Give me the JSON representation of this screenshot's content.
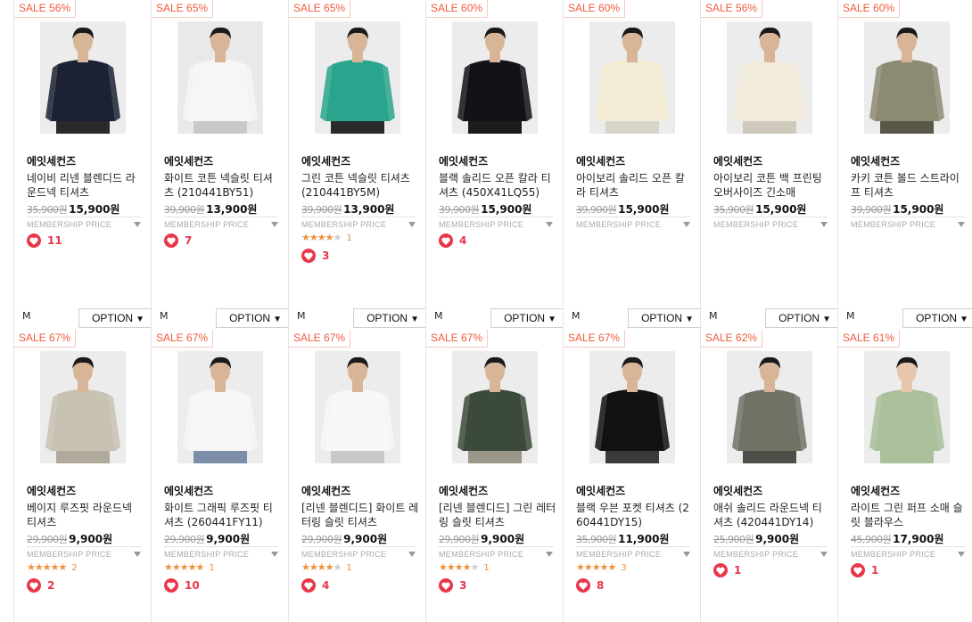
{
  "colors": {
    "sale": "#ef5a3c",
    "heart": "#e8364a",
    "star": "#f0903a"
  },
  "labels": {
    "membership": "MEMBERSHIP PRICE",
    "option": "OPTION",
    "option_arrow": "▼",
    "heart_icon": "heart-icon",
    "stars_icon": "star-rating-icon"
  },
  "rows": [
    {
      "products": [
        {
          "sale": "SALE 56%",
          "brand": "에잇세컨즈",
          "name": "네이비 리넨 블렌디드 라운드넥 티셔츠",
          "orig": "35,900원",
          "price": "15,900원",
          "rating": 0,
          "reviews": "",
          "likes": "11",
          "size": "M",
          "shirt": "#1c2233",
          "skin": "#d8b597",
          "pants": "#2a2a2a",
          "bg": "#ececec"
        },
        {
          "sale": "SALE 65%",
          "brand": "에잇세컨즈",
          "name": "화이트 코튼 넥슬릿 티셔츠 (210441BY51)",
          "orig": "39,900원",
          "price": "13,900원",
          "rating": 0,
          "reviews": "",
          "likes": "7",
          "size": "M",
          "shirt": "#f6f6f4",
          "skin": "#d8b597",
          "pants": "#c9c9c9",
          "bg": "#e9e9e9"
        },
        {
          "sale": "SALE 65%",
          "brand": "에잇세컨즈",
          "name": "그린 코튼 넥슬릿 티셔츠 (210441BY5M)",
          "orig": "39,900원",
          "price": "13,900원",
          "rating": 4,
          "reviews": "1",
          "likes": "3",
          "size": "M",
          "shirt": "#2aa58d",
          "skin": "#d8b597",
          "pants": "#2a2a2a",
          "bg": "#ececec"
        },
        {
          "sale": "SALE 60%",
          "brand": "에잇세컨즈",
          "name": "블랙 솔리드 오픈 칼라 티셔츠 (450X41LQ55)",
          "orig": "39,900원",
          "price": "15,900원",
          "rating": 0,
          "reviews": "",
          "likes": "4",
          "size": "M",
          "shirt": "#111318",
          "skin": "#d8b597",
          "pants": "#1b1b1b",
          "bg": "#ececec"
        },
        {
          "sale": "SALE 60%",
          "brand": "에잇세컨즈",
          "name": "아이보리 솔리드 오픈 칼라 티셔츠",
          "orig": "39,900원",
          "price": "15,900원",
          "rating": 0,
          "reviews": "",
          "likes": "",
          "size": "M",
          "shirt": "#f3ecd4",
          "skin": "#d8b597",
          "pants": "#d8d4c8",
          "bg": "#ececec"
        },
        {
          "sale": "SALE 56%",
          "brand": "에잇세컨즈",
          "name": "아이보리 코튼 백 프린팅 오버사이즈 긴소매",
          "orig": "35,900원",
          "price": "15,900원",
          "rating": 0,
          "reviews": "",
          "likes": "",
          "size": "M",
          "shirt": "#f1ebdc",
          "skin": "#d8b597",
          "pants": "#cfc9bb",
          "bg": "#ececec"
        },
        {
          "sale": "SALE 60%",
          "brand": "에잇세컨즈",
          "name": "카키 코튼 볼드 스트라이프 티셔츠",
          "orig": "39,900원",
          "price": "15,900원",
          "rating": 0,
          "reviews": "",
          "likes": "",
          "size": "M",
          "shirt": "#8d8a74",
          "skin": "#d8b597",
          "pants": "#5a5648",
          "bg": "#ececec"
        }
      ]
    },
    {
      "products": [
        {
          "sale": "SALE 67%",
          "brand": "에잇세컨즈",
          "name": "베이지 루즈핏 라운드넥 티셔츠",
          "orig": "29,900원",
          "price": "9,900원",
          "rating": 4.5,
          "reviews": "2",
          "likes": "2",
          "size": "",
          "shirt": "#c8c2b3",
          "skin": "#d8b597",
          "pants": "#b0aa9c",
          "bg": "#ececec"
        },
        {
          "sale": "SALE 67%",
          "brand": "에잇세컨즈",
          "name": "화이트 그래픽 루즈핏 티셔츠 (260441FY11)",
          "orig": "29,900원",
          "price": "9,900원",
          "rating": 5,
          "reviews": "1",
          "likes": "10",
          "size": "",
          "shirt": "#f7f7f7",
          "skin": "#d8b597",
          "pants": "#7d8fa8",
          "bg": "#ececec"
        },
        {
          "sale": "SALE 67%",
          "brand": "에잇세컨즈",
          "name": "[리넨 블렌디드] 화이트 레터링 슬릿 티셔츠",
          "orig": "29,900원",
          "price": "9,900원",
          "rating": 4,
          "reviews": "1",
          "likes": "4",
          "size": "",
          "shirt": "#f8f8f8",
          "skin": "#d8b597",
          "pants": "#c8c8c8",
          "bg": "#ececec"
        },
        {
          "sale": "SALE 67%",
          "brand": "에잇세컨즈",
          "name": "[리넨 블렌디드] 그린 레터링 슬릿 티셔츠",
          "orig": "29,900원",
          "price": "9,900원",
          "rating": 4,
          "reviews": "1",
          "likes": "3",
          "size": "",
          "shirt": "#3b4a3a",
          "skin": "#d8b597",
          "pants": "#9a9688",
          "bg": "#ececec"
        },
        {
          "sale": "SALE 67%",
          "brand": "에잇세컨즈",
          "name": "블랙 우븐 포켓 티셔츠 (260441DY15)",
          "orig": "35,900원",
          "price": "11,900원",
          "rating": 5,
          "reviews": "3",
          "likes": "8",
          "size": "",
          "shirt": "#111111",
          "skin": "#d8b597",
          "pants": "#3a3a3a",
          "bg": "#ececec"
        },
        {
          "sale": "SALE 62%",
          "brand": "에잇세컨즈",
          "name": "애쉬 솔리드 라운드넥 티셔츠 (420441DY14)",
          "orig": "25,900원",
          "price": "9,900원",
          "rating": 0,
          "reviews": "",
          "likes": "1",
          "size": "",
          "shirt": "#6e7366",
          "skin": "#d8b597",
          "pants": "#4c4e48",
          "bg": "#ececec"
        },
        {
          "sale": "SALE 61%",
          "brand": "에잇세컨즈",
          "name": "라이트 그린 퍼프 소매 슬릿 블라우스",
          "orig": "45,900원",
          "price": "17,900원",
          "rating": 0,
          "reviews": "",
          "likes": "1",
          "size": "",
          "shirt": "#a9c09a",
          "skin": "#e6c6ad",
          "pants": "#a9c09a",
          "bg": "#ececec"
        }
      ]
    }
  ]
}
